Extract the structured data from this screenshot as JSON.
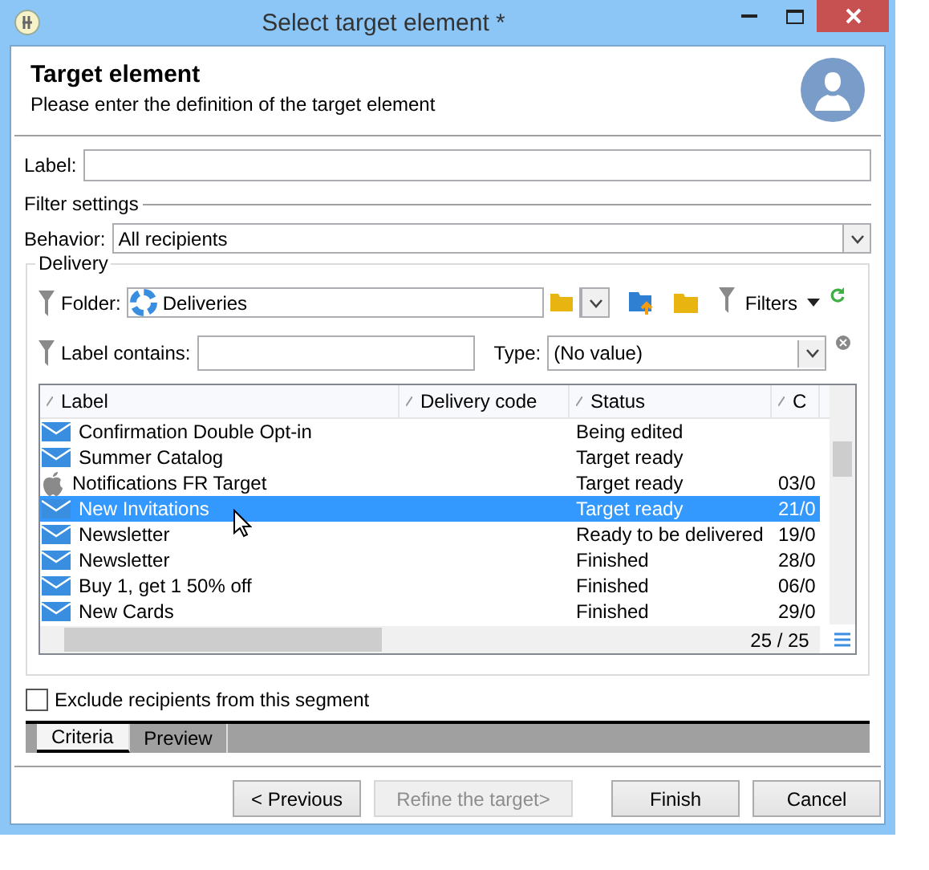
{
  "window": {
    "title": "Select target element *"
  },
  "header": {
    "title": "Target element",
    "subtitle": "Please enter the definition of the target element"
  },
  "label_field": {
    "label": "Label:"
  },
  "filter_settings": {
    "title": "Filter settings",
    "behavior": {
      "label": "Behavior:",
      "value": "All recipients"
    }
  },
  "delivery": {
    "title": "Delivery",
    "folder": {
      "label": "Folder:",
      "value": "Deliveries"
    },
    "filters_button": "Filters",
    "label_contains": {
      "label": "Label contains:"
    },
    "type": {
      "label": "Type:",
      "value": "(No value)"
    },
    "table": {
      "columns": [
        {
          "label": "Label"
        },
        {
          "label": "Delivery code"
        },
        {
          "label": "Status"
        },
        {
          "label": "C"
        }
      ],
      "rows": [
        {
          "kind": "email",
          "label": "Confirmation Double Opt-in",
          "status": "Being edited",
          "selected": false
        },
        {
          "kind": "email",
          "label": "Summer Catalog",
          "status": "Target ready",
          "selected": false
        },
        {
          "kind": "apple",
          "label": "Notifications FR Target",
          "status": "Target ready",
          "column_4": "03/0",
          "selected": false
        },
        {
          "kind": "email",
          "label": "New Invitations",
          "status": "Target ready",
          "column_4": "21/0",
          "selected": true
        },
        {
          "kind": "email",
          "label": "Newsletter",
          "status": "Ready to be delivered",
          "column_4": "19/0",
          "selected": false
        },
        {
          "kind": "email",
          "label": "Newsletter",
          "status": "Finished",
          "column_4": "28/0",
          "selected": false
        },
        {
          "kind": "email",
          "label": "Buy 1, get 1 50% off",
          "status": "Finished",
          "column_4": "06/0",
          "selected": false
        },
        {
          "kind": "email",
          "label": "New Cards",
          "status": "Finished",
          "column_4": "29/0",
          "selected": false
        }
      ],
      "count": "25 / 25"
    }
  },
  "exclude": {
    "label": "Exclude recipients from this segment",
    "checked": false
  },
  "tabs": [
    {
      "label": "Criteria",
      "selected": true
    },
    {
      "label": "Preview",
      "selected": false
    }
  ],
  "buttons": [
    {
      "label": "< Previous",
      "disabled": false
    },
    {
      "label": "Refine the target>",
      "disabled": true
    },
    {
      "label": "Finish",
      "disabled": false
    },
    {
      "label": "Cancel",
      "disabled": false
    }
  ]
}
